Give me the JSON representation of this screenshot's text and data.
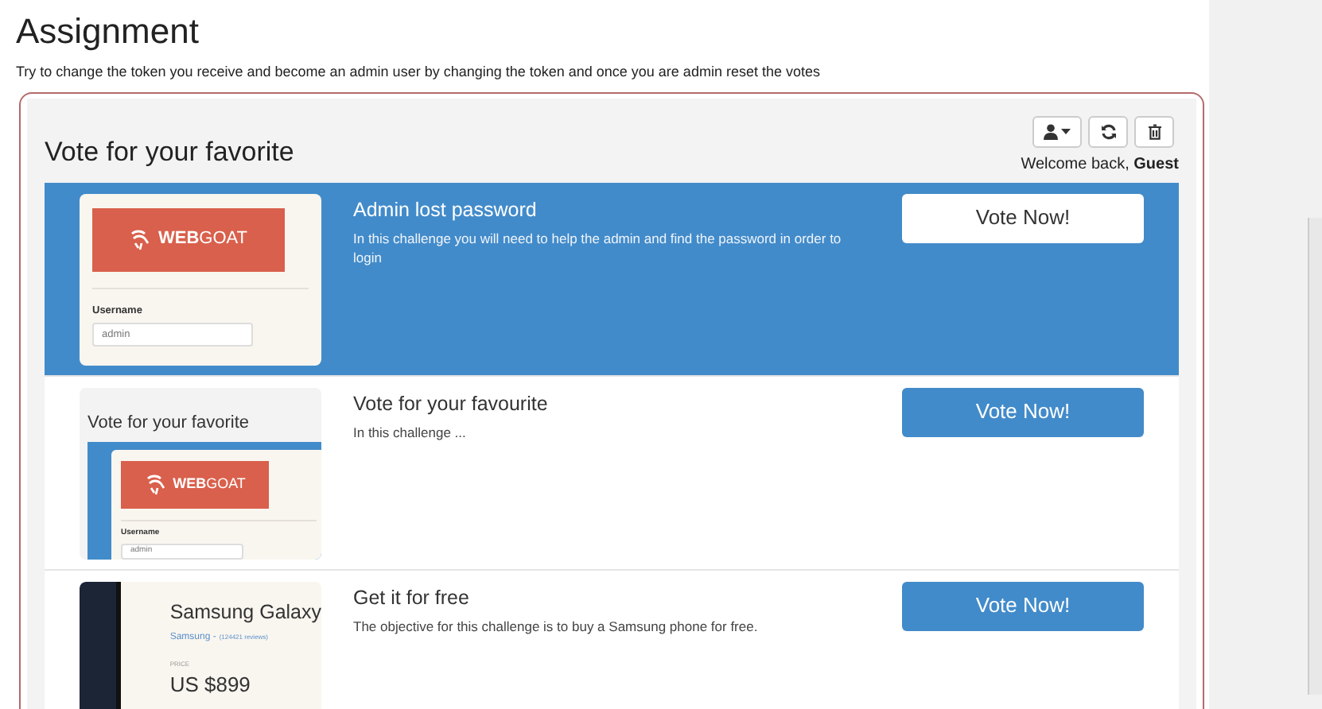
{
  "title": "Assignment",
  "description": "Try to change the token you receive and become an admin user by changing the token and once you are admin reset the votes",
  "panel": {
    "heading": "Vote for your favorite",
    "welcome": "Welcome back, **Guest**"
  },
  "challenges": [
    {
      "title": "Admin lost password",
      "description": "In this challenge you will need to help the admin and find the password in order to login",
      "selected": true,
      "button": "Vote Now!",
      "thumbnail": {
        "kind": "login",
        "logo_bold": "WEB",
        "logo_rest": "GOAT",
        "field_label": "Username",
        "field_value": "admin"
      }
    },
    {
      "title": "Vote for your favourite",
      "description": "In this challenge ...",
      "selected": false,
      "button": "Vote Now!",
      "thumbnail": {
        "kind": "nested",
        "heading": "Vote for your favorite",
        "logo_bold": "WEB",
        "logo_rest": "GOAT",
        "field_label": "Username",
        "field_value": "admin"
      }
    },
    {
      "title": "Get it for free",
      "description": "The objective for this challenge is to buy a Samsung phone for free.",
      "selected": false,
      "button": "Vote Now!",
      "thumbnail": {
        "kind": "product",
        "name": "Samsung Galaxy",
        "brand": "Samsung -",
        "reviews": "(124421 reviews)",
        "price_label": "PRICE",
        "price": "US $899"
      }
    }
  ]
}
